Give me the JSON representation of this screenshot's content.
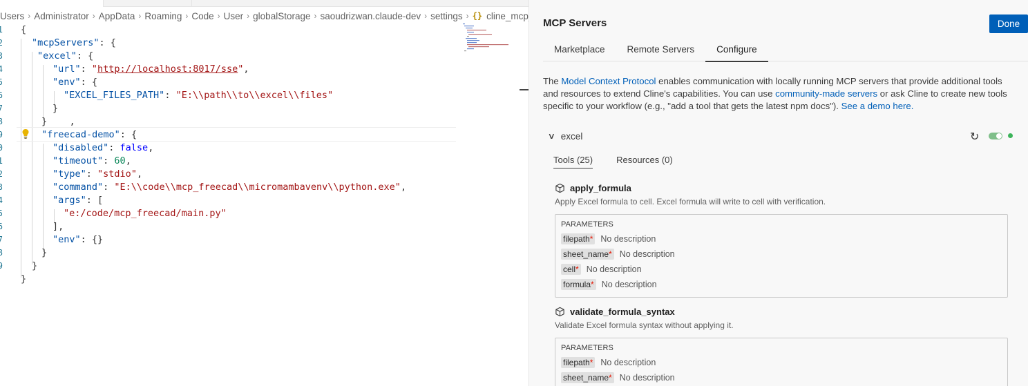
{
  "breadcrumb": {
    "items": [
      "Users",
      "Administrator",
      "AppData",
      "Roaming",
      "Code",
      "User",
      "globalStorage",
      "saoudrizwan.claude-dev",
      "settings"
    ],
    "file_icon": "{}",
    "file": "cline_mcp_s"
  },
  "editor": {
    "line_numbers": [
      "1",
      "2",
      "3",
      "4",
      "5",
      "6",
      "7",
      "8",
      "9",
      "0",
      "1",
      "2",
      "3",
      "4",
      "5",
      "6",
      "7",
      "8",
      "9"
    ],
    "lines": {
      "l1": "{",
      "l2_key": "\"mcpServers\"",
      "l2_rest": ": {",
      "l3_key": "\"excel\"",
      "l3_rest": ": {",
      "l4_key": "\"url\"",
      "l4_colon": ": ",
      "l4_q1": "\"",
      "l4_url": "http://localhost:8017/sse",
      "l4_q2": "\"",
      "l4_end": ",",
      "l5_key": "\"env\"",
      "l5_rest": ": {",
      "l6_key": "\"EXCEL_FILES_PATH\"",
      "l6_colon": ": ",
      "l6_val": "\"E:\\\\path\\\\to\\\\excel\\\\files\"",
      "l7": "}",
      "l8": "}    ,",
      "l9_key": "\"freecad-demo\"",
      "l9_rest": ": {",
      "l10_key": "\"disabled\"",
      "l10_colon": ": ",
      "l10_val": "false",
      "l10_end": ",",
      "l11_key": "\"timeout\"",
      "l11_colon": ": ",
      "l11_val": "60",
      "l11_end": ",",
      "l12_key": "\"type\"",
      "l12_colon": ": ",
      "l12_val": "\"stdio\"",
      "l12_end": ",",
      "l13_key": "\"command\"",
      "l13_colon": ": ",
      "l13_val": "\"E:\\\\code\\\\mcp_freecad\\\\micromambavenv\\\\python.exe\"",
      "l13_end": ",",
      "l14_key": "\"args\"",
      "l14_rest": ": [",
      "l15_val": "\"e:/code/mcp_freecad/main.py\"",
      "l16": "],",
      "l17_key": "\"env\"",
      "l17_colon": ": ",
      "l17_val": "{}",
      "l18": "}",
      "l19": "}",
      "l20": "}"
    }
  },
  "panel": {
    "title": "MCP Servers",
    "done_label": "Done",
    "tabs": [
      "Marketplace",
      "Remote Servers",
      "Configure"
    ],
    "active_tab": "Configure",
    "intro": {
      "t1": "The ",
      "link1": "Model Context Protocol",
      "t2": " enables communication with locally running MCP servers that provide additional tools and resources to extend Cline's capabilities. You can use ",
      "link2": "community-made servers",
      "t3": " or ask Cline to create new tools specific to your workflow (e.g., \"add a tool that gets the latest npm docs\"). ",
      "link3": "See a demo here."
    },
    "server": {
      "name": "excel",
      "enabled": true,
      "status_color": "#3cb45a",
      "tabs": [
        "Tools (25)",
        "Resources (0)"
      ]
    },
    "params_title": "PARAMETERS",
    "required_mark": "*",
    "tools": [
      {
        "name": "apply_formula",
        "description": "Apply Excel formula to cell. Excel formula will write to cell with verification.",
        "params": [
          {
            "name": "filepath",
            "desc": "No description"
          },
          {
            "name": "sheet_name",
            "desc": "No description"
          },
          {
            "name": "cell",
            "desc": "No description"
          },
          {
            "name": "formula",
            "desc": "No description"
          }
        ]
      },
      {
        "name": "validate_formula_syntax",
        "description": "Validate Excel formula syntax without applying it.",
        "params": [
          {
            "name": "filepath",
            "desc": "No description"
          },
          {
            "name": "sheet_name",
            "desc": "No description"
          }
        ]
      }
    ]
  },
  "colors": {
    "accent": "#005fb8",
    "json_key": "#0451a5",
    "json_string": "#a31515",
    "json_number": "#098658",
    "json_keyword": "#0000ff"
  }
}
